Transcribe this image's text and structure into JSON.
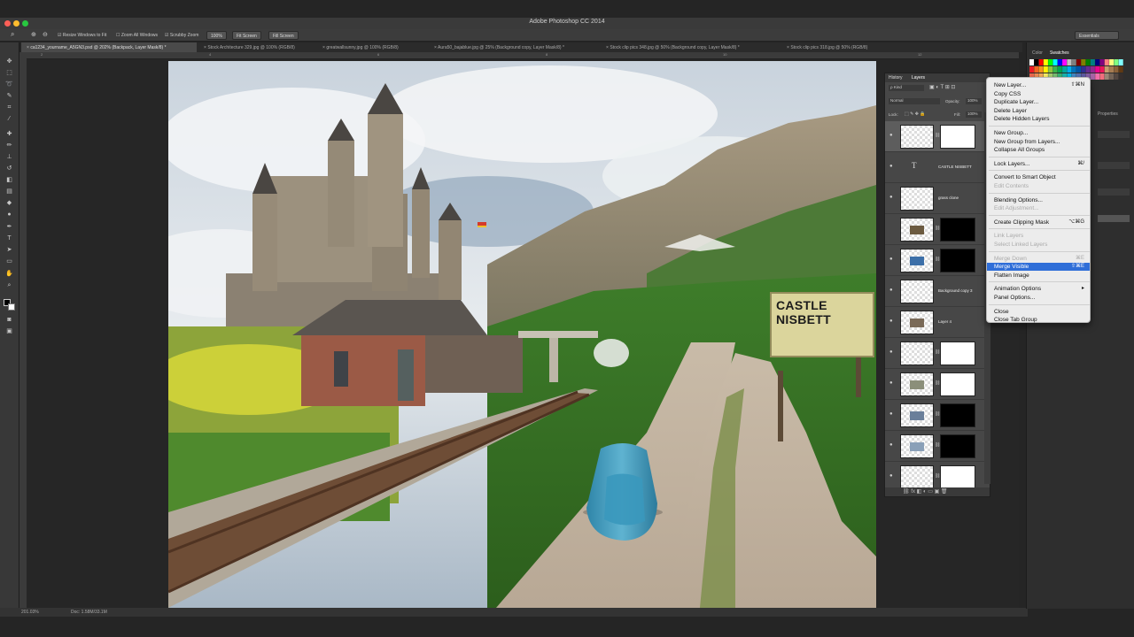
{
  "window": {
    "title": "Adobe Photoshop CC 2014"
  },
  "options_bar": {
    "resize_windows": "Resize Windows to Fit",
    "zoom_all": "Zoom All Windows",
    "scrubby_zoom": "Scrubby Zoom",
    "btn_100": "100%",
    "btn_fit": "Fit Screen",
    "btn_fill": "Fill Screen",
    "workspace": "Essentials"
  },
  "doc_tabs": [
    "ca1234_yourname_A5GN3.psd @ 202% (Backpack, Layer Mask/8) *",
    "Stock Architecture 329.jpg @ 100% (RGB/8)",
    "greatwallsunny.jpg @ 100% (RGB/8)",
    "Aura50_bajablue.jpg @ 25% (Background copy, Layer Mask/8) *",
    "Stock clip pics 348.jpg @ 50% (Background copy, Layer Mask/8) *",
    "Stock clip pics 318.jpg @ 50% (RGB/8)"
  ],
  "ruler_numbers": [
    "2",
    "4",
    "6",
    "8",
    "10",
    "12"
  ],
  "status": {
    "zoom": "201.03%",
    "doc": "Doc: 1.58M/33.1M"
  },
  "canvas": {
    "sign_text": "CASTLE NISBETT"
  },
  "right_panel": {
    "color_tab": "Color",
    "swatches_tab": "Swatches",
    "properties": "Properties"
  },
  "layers_panel": {
    "history_tab": "History",
    "layers_tab": "Layers",
    "kind": "Kind",
    "blend_mode": "Normal",
    "opacity_label": "Opacity:",
    "opacity_value": "100%",
    "lock_label": "Lock:",
    "fill_label": "Fill:",
    "fill_value": "100%",
    "layers": [
      {
        "name": "",
        "has_mask": true
      },
      {
        "name": "CASTLE NISBETT",
        "type": "text"
      },
      {
        "name": "grass clone",
        "has_mask": false
      },
      {
        "name": "",
        "has_mask": true
      },
      {
        "name": "",
        "has_mask": true
      },
      {
        "name": "Background copy 3",
        "has_mask": false
      },
      {
        "name": "Layer 4",
        "has_mask": false
      },
      {
        "name": "",
        "has_mask": true
      },
      {
        "name": "",
        "has_mask": true
      },
      {
        "name": "",
        "has_mask": true
      },
      {
        "name": "",
        "has_mask": true
      },
      {
        "name": "",
        "has_mask": true
      }
    ]
  },
  "context_menu": {
    "items": [
      {
        "label": "New Layer...",
        "shortcut": "⇧⌘N",
        "enabled": true
      },
      {
        "label": "Copy CSS",
        "shortcut": "",
        "enabled": true
      },
      {
        "label": "Duplicate Layer...",
        "shortcut": "",
        "enabled": true
      },
      {
        "label": "Delete Layer",
        "shortcut": "",
        "enabled": true
      },
      {
        "label": "Delete Hidden Layers",
        "shortcut": "",
        "enabled": true
      },
      {
        "sep": true
      },
      {
        "label": "New Group...",
        "shortcut": "",
        "enabled": true
      },
      {
        "label": "New Group from Layers...",
        "shortcut": "",
        "enabled": true
      },
      {
        "label": "Collapse All Groups",
        "shortcut": "",
        "enabled": true
      },
      {
        "sep": true
      },
      {
        "label": "Lock Layers...",
        "shortcut": "⌘/",
        "enabled": true
      },
      {
        "sep": true
      },
      {
        "label": "Convert to Smart Object",
        "shortcut": "",
        "enabled": true
      },
      {
        "label": "Edit Contents",
        "shortcut": "",
        "enabled": false
      },
      {
        "sep": true
      },
      {
        "label": "Blending Options...",
        "shortcut": "",
        "enabled": true
      },
      {
        "label": "Edit Adjustment...",
        "shortcut": "",
        "enabled": false
      },
      {
        "sep": true
      },
      {
        "label": "Create Clipping Mask",
        "shortcut": "⌥⌘G",
        "enabled": true
      },
      {
        "sep": true
      },
      {
        "label": "Link Layers",
        "shortcut": "",
        "enabled": false
      },
      {
        "label": "Select Linked Layers",
        "shortcut": "",
        "enabled": false
      },
      {
        "sep": true
      },
      {
        "label": "Merge Down",
        "shortcut": "⌘E",
        "enabled": false
      },
      {
        "label": "Merge Visible",
        "shortcut": "⇧⌘E",
        "enabled": true,
        "selected": true
      },
      {
        "label": "Flatten Image",
        "shortcut": "",
        "enabled": true
      },
      {
        "sep": true
      },
      {
        "label": "Animation Options",
        "shortcut": "▸",
        "enabled": true
      },
      {
        "label": "Panel Options...",
        "shortcut": "",
        "enabled": true
      },
      {
        "sep": true
      },
      {
        "label": "Close",
        "shortcut": "",
        "enabled": true
      },
      {
        "label": "Close Tab Group",
        "shortcut": "",
        "enabled": true
      }
    ]
  }
}
